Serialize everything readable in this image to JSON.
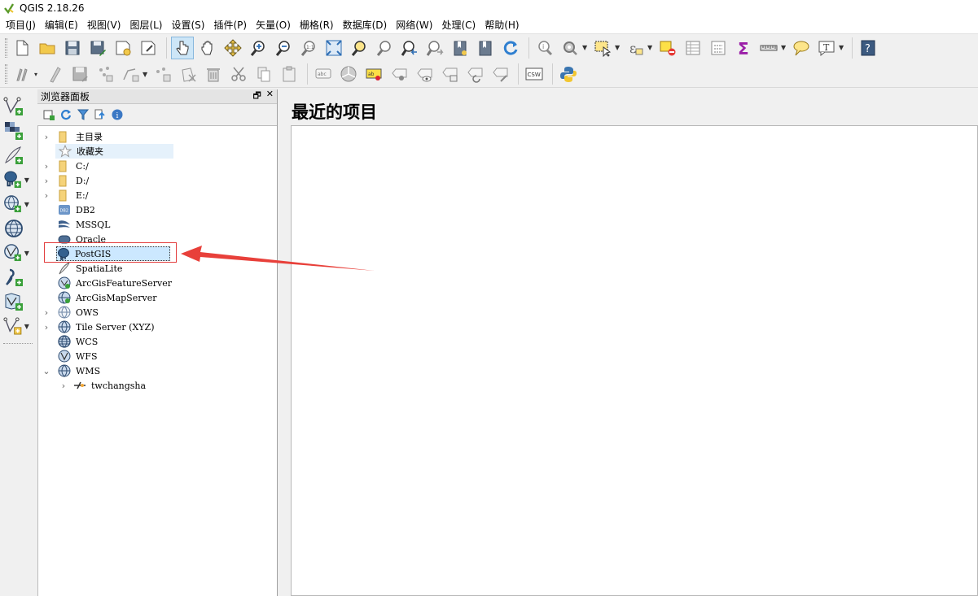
{
  "window": {
    "title": "QGIS 2.18.26"
  },
  "menubar": {
    "items": [
      "项目(J)",
      "编辑(E)",
      "视图(V)",
      "图层(L)",
      "设置(S)",
      "插件(P)",
      "矢量(O)",
      "栅格(R)",
      "数据库(D)",
      "网络(W)",
      "处理(C)",
      "帮助(H)"
    ]
  },
  "browser_panel": {
    "title": "浏览器面板",
    "tree": [
      {
        "label": "主目录",
        "icon": "folder-icon",
        "expandable": true
      },
      {
        "label": "收藏夹",
        "icon": "star-icon",
        "expandable": false
      },
      {
        "label": "C:/",
        "icon": "folder-icon",
        "expandable": true
      },
      {
        "label": "D:/",
        "icon": "folder-icon",
        "expandable": true
      },
      {
        "label": "E:/",
        "icon": "folder-icon",
        "expandable": true
      },
      {
        "label": "DB2",
        "icon": "db2-icon",
        "expandable": false
      },
      {
        "label": "MSSQL",
        "icon": "mssql-icon",
        "expandable": false
      },
      {
        "label": "Oracle",
        "icon": "oracle-icon",
        "expandable": false
      },
      {
        "label": "PostGIS",
        "icon": "postgis-elephant-icon",
        "expandable": false
      },
      {
        "label": "SpatiaLite",
        "icon": "spatialite-feather-icon",
        "expandable": false
      },
      {
        "label": "ArcGisFeatureServer",
        "icon": "arcgis-feature-server-icon",
        "expandable": false
      },
      {
        "label": "ArcGisMapServer",
        "icon": "arcgis-map-server-icon",
        "expandable": false
      },
      {
        "label": "OWS",
        "icon": "ows-globe-icon",
        "expandable": true
      },
      {
        "label": "Tile Server (XYZ)",
        "icon": "xyz-tile-icon",
        "expandable": true
      },
      {
        "label": "WCS",
        "icon": "wcs-globe-icon",
        "expandable": false
      },
      {
        "label": "WFS",
        "icon": "wfs-globe-icon",
        "expandable": false
      },
      {
        "label": "WMS",
        "icon": "wms-globe-icon",
        "expandable": true,
        "expanded": true
      },
      {
        "label": "twchangsha",
        "icon": "connection-icon",
        "expandable": true,
        "indent": 1
      }
    ]
  },
  "main": {
    "recent_projects_title": "最近的项目"
  },
  "colors": {
    "highlight_box": "#e23c3c",
    "annotation_arrow": "#e8403a",
    "selection_bg": "#cce8ff"
  }
}
